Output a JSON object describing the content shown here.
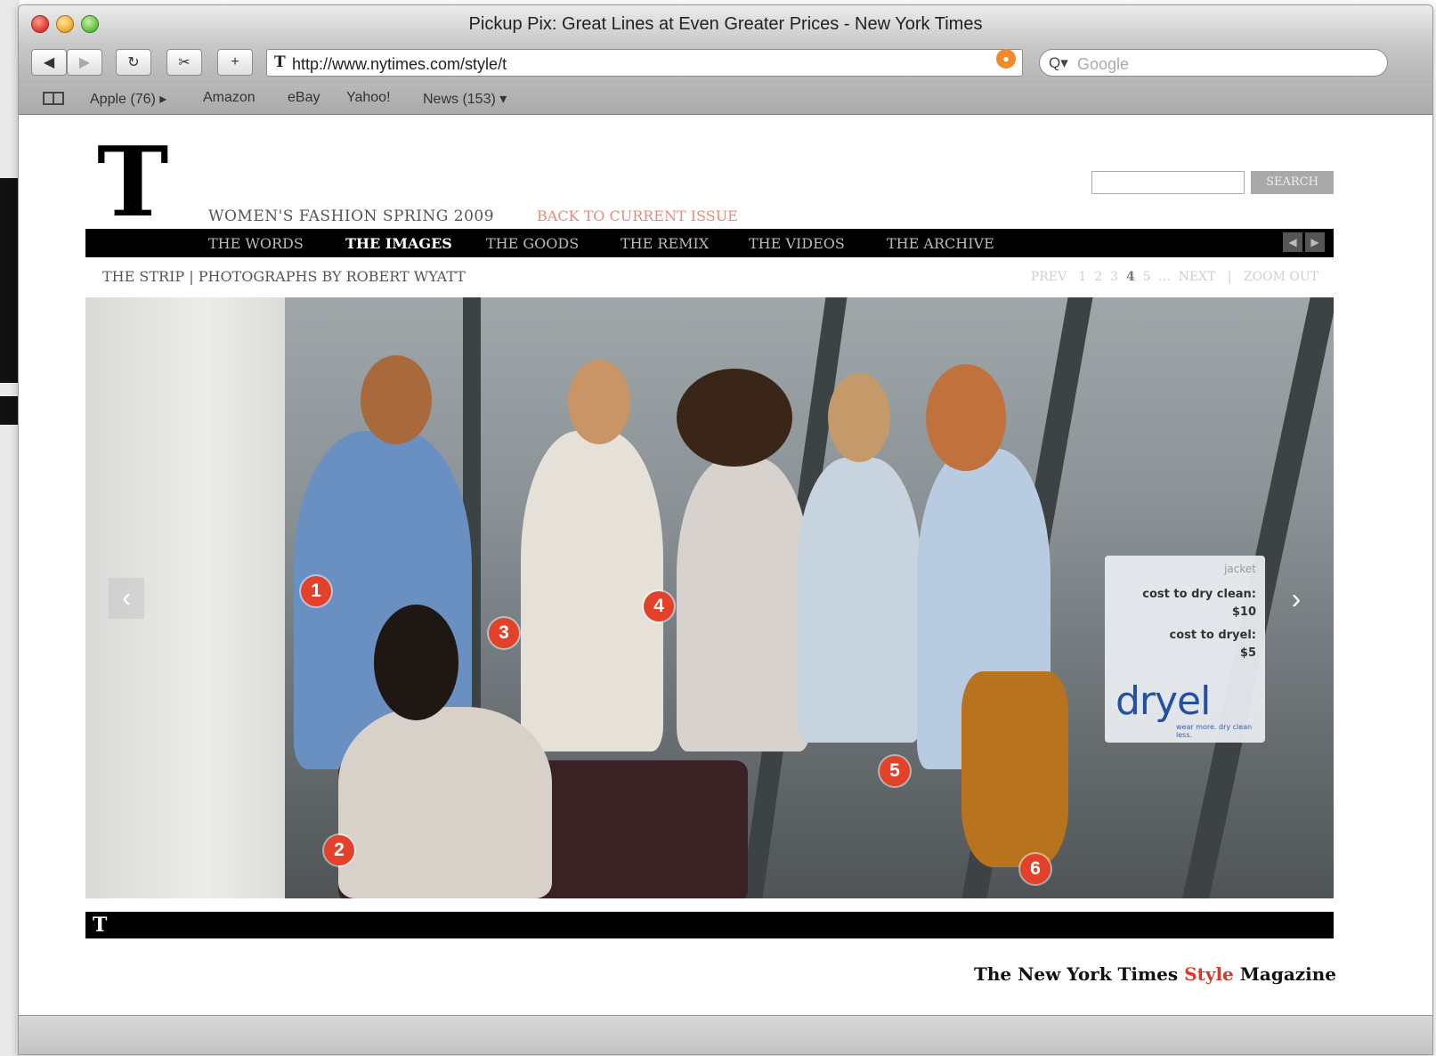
{
  "window": {
    "title": "Pickup Pix: Great Lines at Even Greater Prices - New York Times"
  },
  "toolbar": {
    "back_icon": "◀",
    "forward_icon": "▶",
    "reload_icon": "↻",
    "snapback_icon": "✂",
    "add_icon": "+",
    "url": "http://www.nytimes.com/style/t",
    "search_placeholder": "Google",
    "search_icon": "Q▾"
  },
  "bookmarks": [
    "Apple (76) ▸",
    "Amazon",
    "eBay",
    "Yahoo!",
    "News (153) ▾"
  ],
  "page": {
    "logo": "T",
    "section_title": "WOMEN'S FASHION SPRING 2009",
    "back_link": "BACK TO CURRENT ISSUE",
    "search_button": "SEARCH",
    "nav": [
      "THE WORDS",
      "THE IMAGES",
      "THE GOODS",
      "THE REMIX",
      "THE VIDEOS",
      "THE ARCHIVE"
    ],
    "nav_active": "THE IMAGES",
    "subheader": "THE STRIP | PHOTOGRAPHS BY ROBERT WYATT",
    "pager": {
      "prev": "PREV",
      "pages": [
        "1",
        "2",
        "3",
        "4",
        "5"
      ],
      "current": "4",
      "ellipsis": "...",
      "next": "NEXT",
      "sep": "|",
      "zoom": "ZOOM OUT"
    },
    "hotspots": [
      "1",
      "2",
      "3",
      "4",
      "5",
      "6"
    ],
    "tooltip": {
      "item": "jacket",
      "line1": "cost to dry clean:",
      "line2": "$10",
      "line3": "cost to dryel:",
      "line4": "$5",
      "brand": "dryel",
      "brand_tag": "wear more. dry clean less."
    },
    "footer_logo": "T",
    "masthead_pre": "The New York Times",
    "masthead_style": "Style",
    "masthead_post": "Magazine"
  }
}
